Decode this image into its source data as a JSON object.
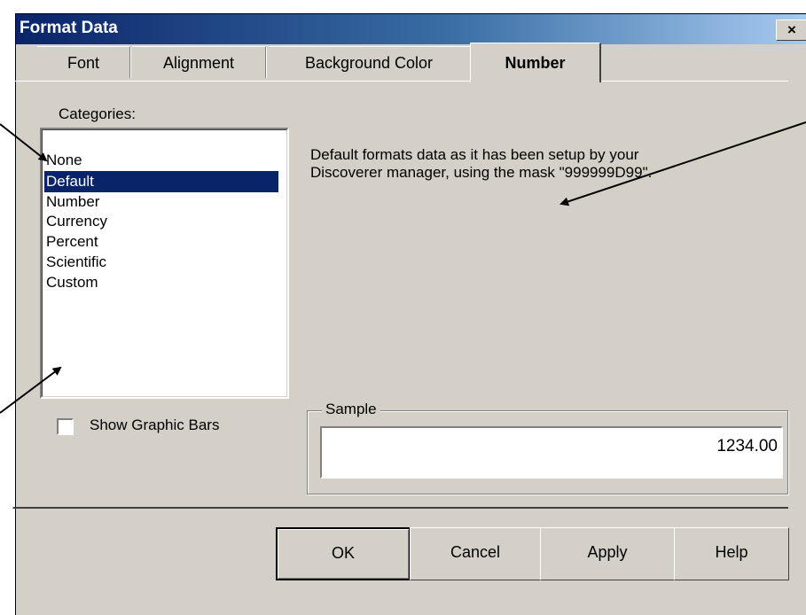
{
  "window": {
    "title": "Format Data",
    "close_label": "×"
  },
  "tabs": [
    {
      "label": "Font"
    },
    {
      "label": "Alignment"
    },
    {
      "label": "Background Color"
    },
    {
      "label": "Number",
      "active": true
    }
  ],
  "categories": {
    "label": "Categories:",
    "items": [
      "None",
      "Default",
      "Number",
      "Currency",
      "Percent",
      "Scientific",
      "Custom"
    ],
    "selected": "Default"
  },
  "description": {
    "line1": "Default formats data as it has been setup by your",
    "line2": "Discoverer manager, using the mask \"999999D99\"."
  },
  "show_graphic_bars": {
    "label": "Show Graphic Bars",
    "checked": false
  },
  "sample": {
    "legend": "Sample",
    "value": "1234.00"
  },
  "buttons": {
    "ok": "OK",
    "cancel": "Cancel",
    "apply": "Apply",
    "help": "Help"
  },
  "colors": {
    "titlebar_start": "#0a246a",
    "titlebar_end": "#a6caf0",
    "selection": "#0a246a",
    "dialog_bg": "#d4d0c8"
  },
  "annotations": {
    "arrow_color": "#000000",
    "count": 3
  }
}
